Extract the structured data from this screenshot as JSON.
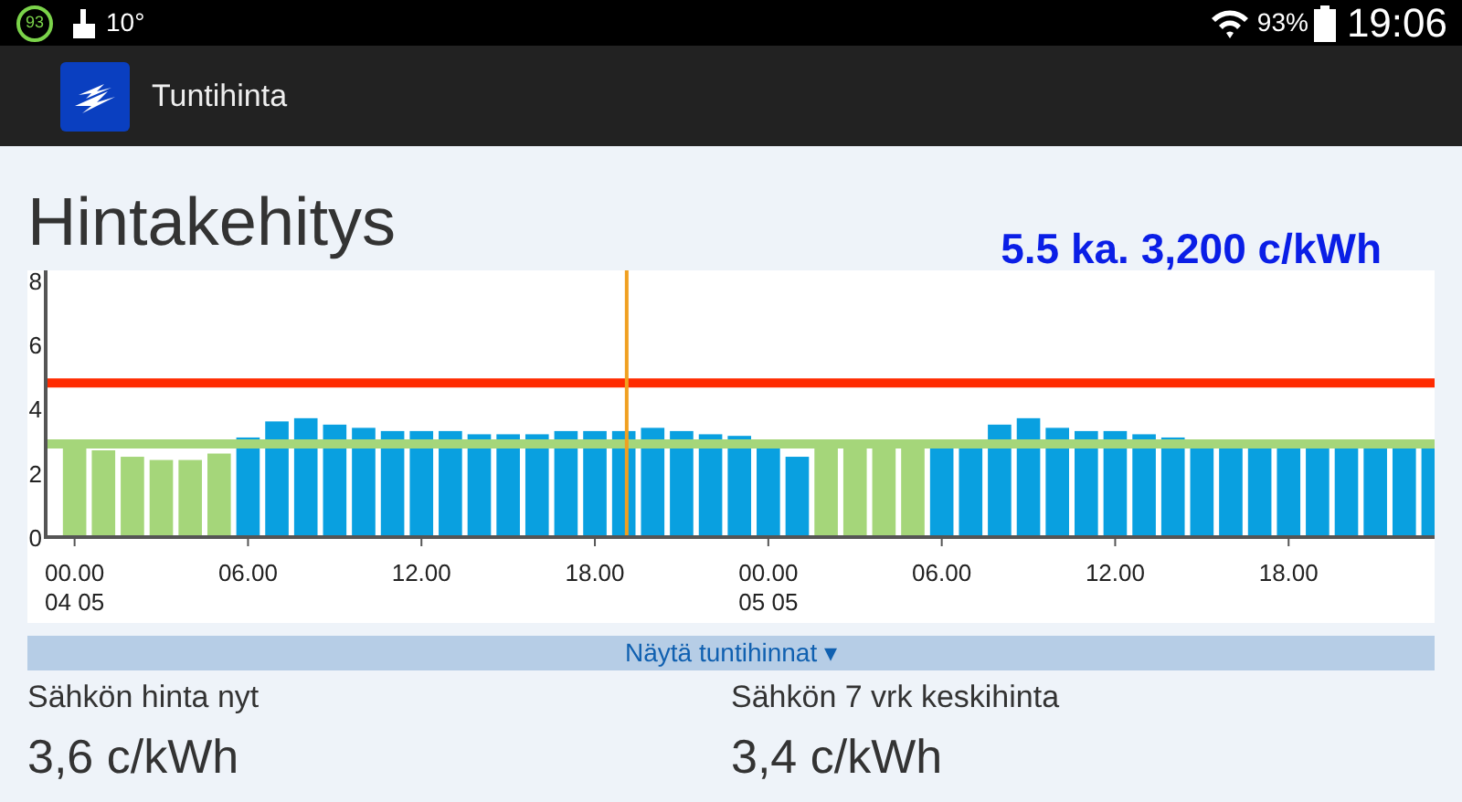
{
  "status_bar": {
    "badge": "93",
    "temperature": "10°",
    "battery": "93%",
    "time": "19:06"
  },
  "app_bar": {
    "title": "Tuntihinta"
  },
  "heading": "Hintakehitys",
  "summary": "5.5 ka. 3,200 c/kWh",
  "chart_data": {
    "type": "bar",
    "categories": [
      "00.00 04 05",
      null,
      null,
      null,
      null,
      null,
      "06.00",
      null,
      null,
      null,
      null,
      null,
      "12.00",
      null,
      null,
      null,
      null,
      null,
      "18.00",
      null,
      null,
      null,
      null,
      null,
      "00.00 05 05",
      null,
      null,
      null,
      null,
      null,
      "06.00",
      null,
      null,
      null,
      null,
      null,
      "12.00",
      null,
      null,
      null,
      null,
      null,
      "18.00",
      null,
      null,
      null,
      null,
      null
    ],
    "series": [
      {
        "color": "#a5d67a",
        "values": [
          2.8,
          2.7,
          2.5,
          2.4,
          2.4,
          2.6,
          null,
          null,
          null,
          null,
          null,
          null,
          null,
          null,
          null,
          null,
          null,
          null,
          null,
          null,
          null,
          null,
          null,
          null,
          null,
          null,
          2.8,
          2.8,
          2.8,
          2.8,
          null,
          null,
          null,
          null,
          null,
          null,
          null,
          null,
          null,
          null,
          null,
          null,
          null,
          null,
          null,
          null,
          null,
          null
        ]
      },
      {
        "color": "#09a0e0",
        "values": [
          null,
          null,
          null,
          null,
          null,
          null,
          3.1,
          3.6,
          3.7,
          3.5,
          3.4,
          3.3,
          3.3,
          3.3,
          3.2,
          3.2,
          3.2,
          3.3,
          3.3,
          3.3,
          3.4,
          3.3,
          3.2,
          3.15,
          2.8,
          2.5,
          null,
          null,
          null,
          null,
          2.8,
          2.9,
          3.5,
          3.7,
          3.4,
          3.3,
          3.3,
          3.2,
          3.1,
          2.9,
          2.9,
          2.9,
          2.9,
          2.9,
          2.9,
          2.9,
          2.9,
          2.9
        ]
      }
    ],
    "ylim": [
      0,
      8.3
    ],
    "yticks": [
      0,
      2,
      4,
      6,
      8
    ],
    "ref_lines": [
      {
        "axis": "y",
        "value": 4.8,
        "color": "#ff2a00"
      },
      {
        "axis": "y",
        "value": 2.9,
        "color": "#a5d67a"
      }
    ]
  },
  "toggle_button": {
    "label": "Näytä tuntihinnat",
    "arrow": "▾"
  },
  "stats": [
    {
      "label": "Sähkön hinta nyt",
      "value": "3,6 c/kWh"
    },
    {
      "label": "Sähkön 7 vrk keskihinta",
      "value": "3,4 c/kWh"
    }
  ]
}
